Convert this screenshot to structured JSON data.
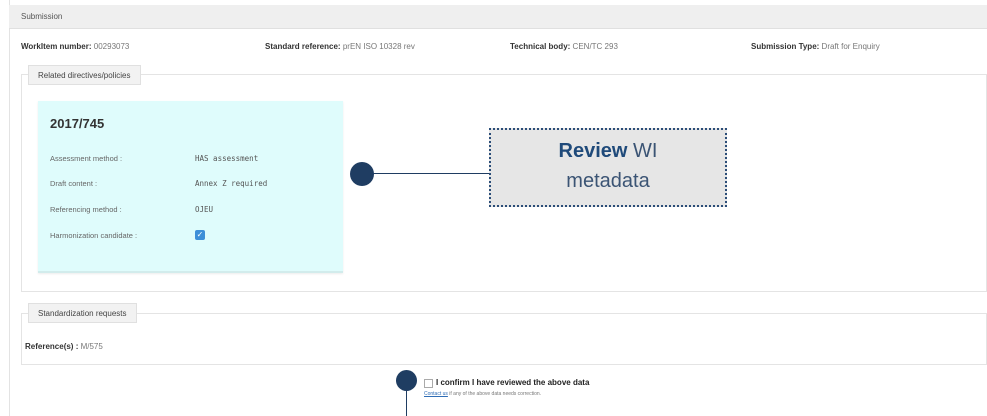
{
  "header": {
    "title": "Submission"
  },
  "meta": {
    "workitem_label": "WorkItem number:",
    "workitem_value": "00293073",
    "standard_label": "Standard reference:",
    "standard_value": "prEN ISO 10328 rev",
    "technical_label": "Technical body:",
    "technical_value": "CEN/TC 293",
    "type_label": "Submission Type:",
    "type_value": "Draft for Enquiry"
  },
  "directives": {
    "legend": "Related directives/policies",
    "card": {
      "title": "2017/745",
      "rows": [
        {
          "label": "Assessment method :",
          "value": "HAS assessment"
        },
        {
          "label": "Draft content :",
          "value": "Annex Z required"
        },
        {
          "label": "Referencing method :",
          "value": "OJEU"
        },
        {
          "label": "Harmonization candidate :",
          "checked": true
        }
      ]
    }
  },
  "callout": {
    "bold": "Review",
    "rest": "WI",
    "line2": "metadata"
  },
  "requests": {
    "legend": "Standardization requests",
    "ref_label": "Reference(s) :",
    "ref_value": "M/575"
  },
  "confirm": {
    "label": "I confirm I have reviewed the above data",
    "link": "Contact us",
    "help": " if any of the above data needs correction.",
    "checked": false
  },
  "colors": {
    "accent": "#1f3d62",
    "card_bg": "#dffcfc",
    "checkbox": "#3d8fd8"
  }
}
